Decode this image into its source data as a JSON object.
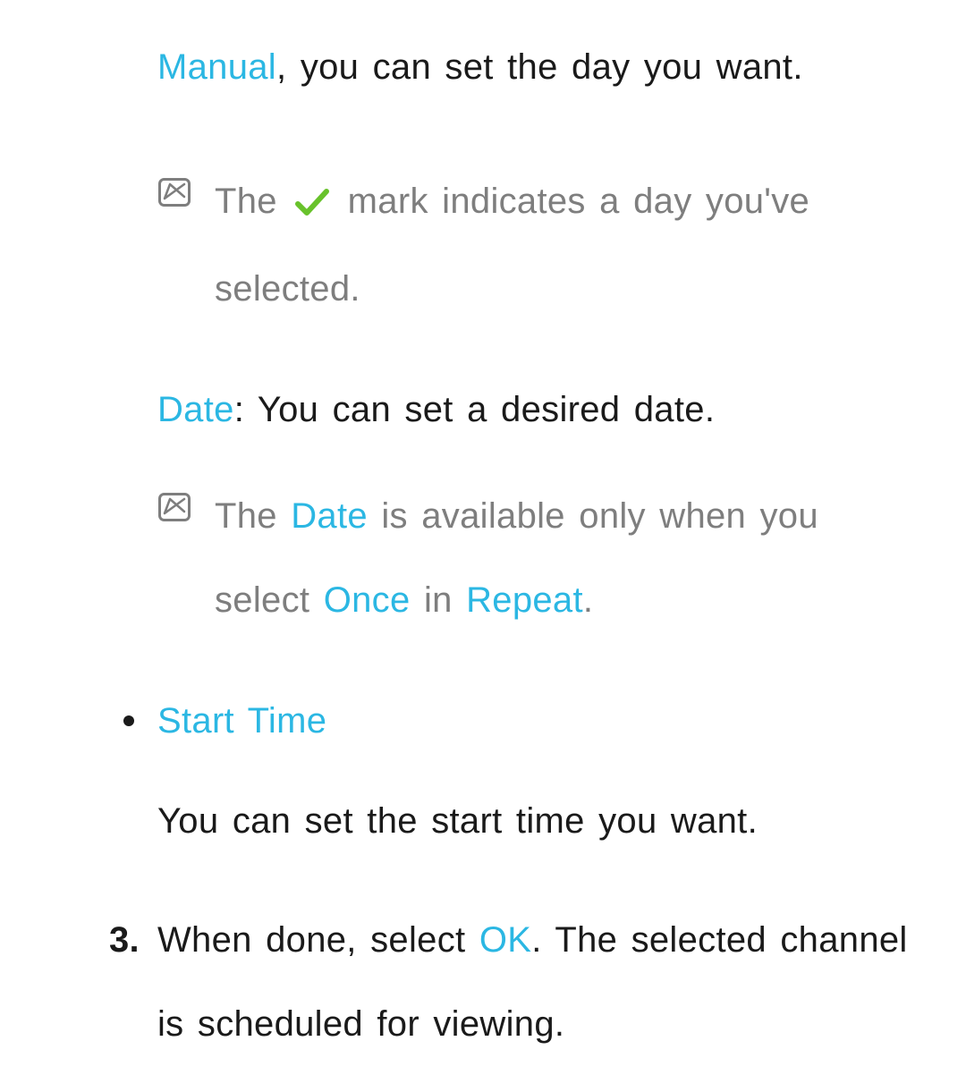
{
  "p1": {
    "manual": "Manual",
    "text": ", you can set the day you want."
  },
  "note1": {
    "pre": "The ",
    "post": " mark indicates a day you've selected."
  },
  "p2": {
    "date": "Date",
    "text": ": You can set a desired date."
  },
  "note2": {
    "pre": "The ",
    "date": "Date",
    "mid": " is available only when you select ",
    "once": "Once",
    "mid2": " in ",
    "repeat": "Repeat",
    "end": "."
  },
  "startTime": {
    "heading": "Start Time",
    "body": "You can set the start time you want."
  },
  "step3": {
    "num": "3.",
    "pre": "When done, select ",
    "ok": "OK",
    "post": ". The selected channel is scheduled for viewing."
  }
}
